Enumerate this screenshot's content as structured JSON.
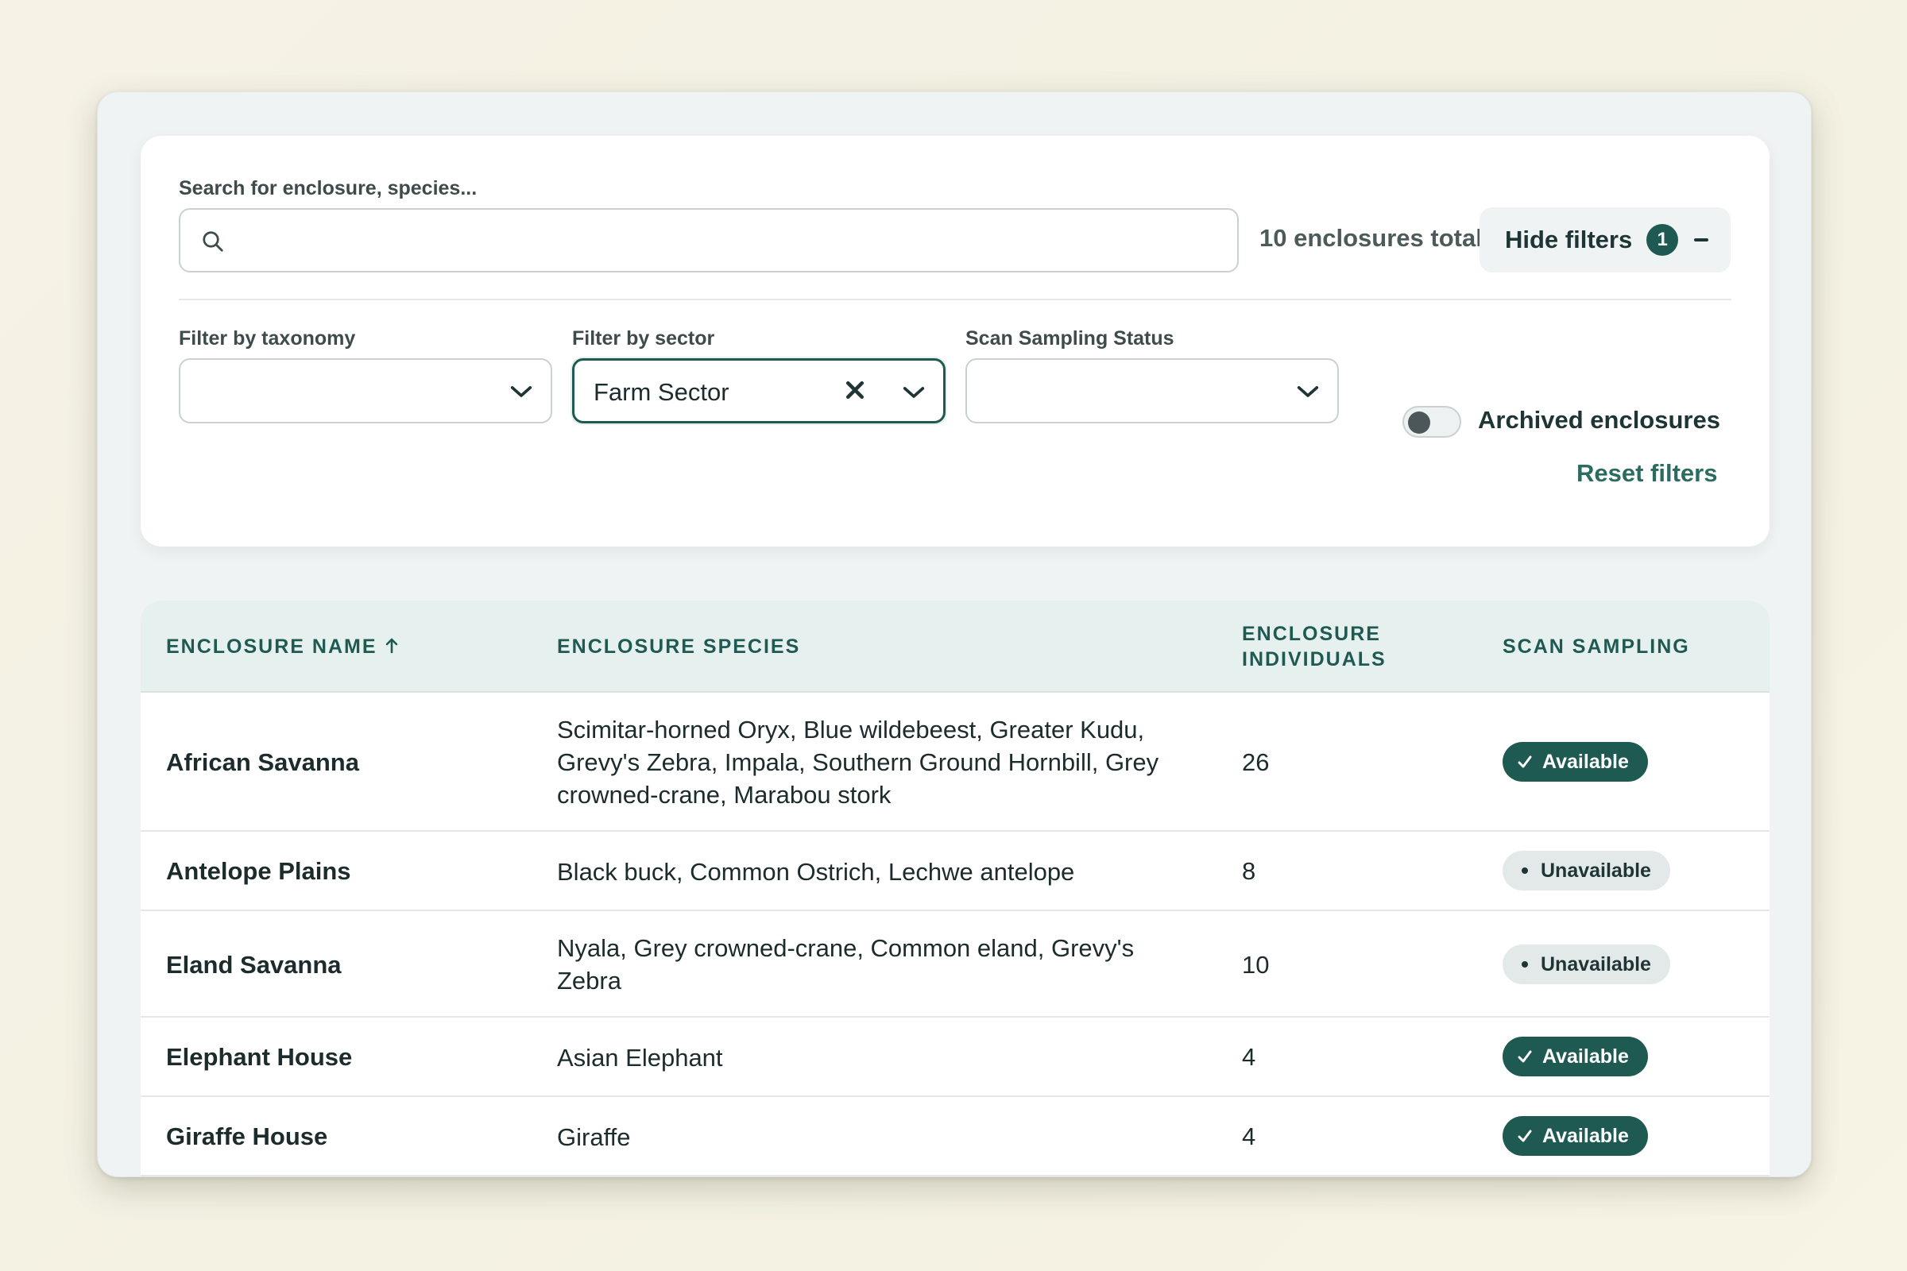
{
  "search": {
    "label": "Search for enclosure, species...",
    "value": "",
    "placeholder": ""
  },
  "summary": {
    "total_text": "10 enclosures total"
  },
  "hide_filters": {
    "label": "Hide filters",
    "badge_count": "1"
  },
  "filters": {
    "taxonomy": {
      "label": "Filter by taxonomy",
      "value": ""
    },
    "sector": {
      "label": "Filter by sector",
      "value": "Farm Sector"
    },
    "scan_status": {
      "label": "Scan Sampling Status",
      "value": ""
    },
    "archived": {
      "label": "Archived enclosures",
      "on": false
    },
    "reset_label": "Reset filters"
  },
  "table": {
    "headers": {
      "name": "ENCLOSURE NAME",
      "species": "ENCLOSURE SPECIES",
      "individuals_line1": "ENCLOSURE",
      "individuals_line2": "INDIVIDUALS",
      "scan": "SCAN SAMPLING"
    },
    "rows": [
      {
        "name": "African Savanna",
        "species": "Scimitar-horned Oryx, Blue wildebeest, Greater Kudu, Grevy's Zebra, Impala, Southern Ground Hornbill, Grey crowned-crane, Marabou stork",
        "individuals": "26",
        "status": "Available"
      },
      {
        "name": "Antelope Plains",
        "species": "Black buck, Common Ostrich, Lechwe antelope",
        "individuals": "8",
        "status": "Unavailable"
      },
      {
        "name": "Eland Savanna",
        "species": "Nyala, Grey crowned-crane, Common eland, Grevy's Zebra",
        "individuals": "10",
        "status": "Unavailable"
      },
      {
        "name": "Elephant House",
        "species": "Asian Elephant",
        "individuals": "4",
        "status": "Available"
      },
      {
        "name": "Giraffe House",
        "species": "Giraffe",
        "individuals": "4",
        "status": "Available"
      }
    ]
  },
  "colors": {
    "accent": "#1f5a52",
    "header_bg": "#e6f0ee",
    "page_bg": "#f6f3e6"
  },
  "icons": {
    "search": "search-icon",
    "chevron": "chevron-down-icon",
    "clear": "close-icon",
    "sort": "arrow-up-icon",
    "available": "check-icon"
  }
}
